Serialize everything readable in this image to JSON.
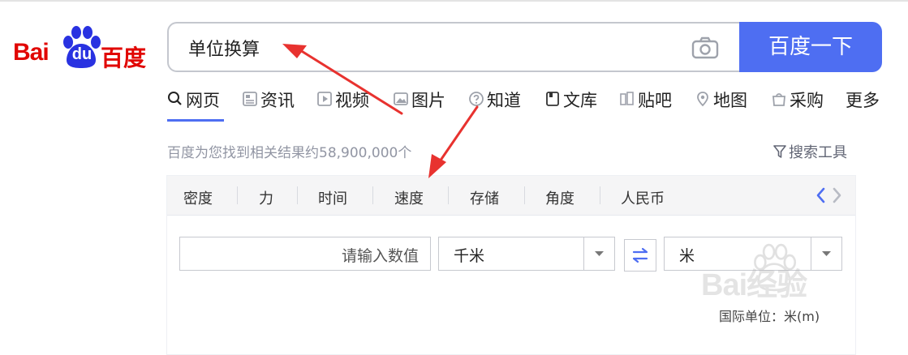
{
  "logo": {
    "bai": "Bai",
    "du": "du",
    "cn": "百度"
  },
  "search": {
    "query": "单位换算",
    "button_label": "百度一下"
  },
  "tabs": [
    {
      "label": "网页",
      "icon": "search-icon",
      "active": true
    },
    {
      "label": "资讯",
      "icon": "news-icon"
    },
    {
      "label": "视频",
      "icon": "video-icon"
    },
    {
      "label": "图片",
      "icon": "image-icon"
    },
    {
      "label": "知道",
      "icon": "question-icon"
    },
    {
      "label": "文库",
      "icon": "document-icon"
    },
    {
      "label": "贴吧",
      "icon": "tieba-icon"
    },
    {
      "label": "地图",
      "icon": "map-pin-icon"
    },
    {
      "label": "采购",
      "icon": "shopping-icon"
    },
    {
      "label": "更多"
    }
  ],
  "results": {
    "count_text": "百度为您找到相关结果约58,900,000个",
    "tools_label": "搜索工具"
  },
  "converter": {
    "categories": [
      "密度",
      "力",
      "时间",
      "速度",
      "存储",
      "角度",
      "人民币"
    ],
    "value_placeholder": "请输入数值",
    "from_unit": "千米",
    "to_unit": "米",
    "si_note": "国际单位：米(m)"
  },
  "watermark": {
    "text": "Bai经验"
  },
  "colors": {
    "brand_red": "#e10602",
    "accent_blue": "#4e6ef2",
    "arrow_red": "#e8322f"
  }
}
